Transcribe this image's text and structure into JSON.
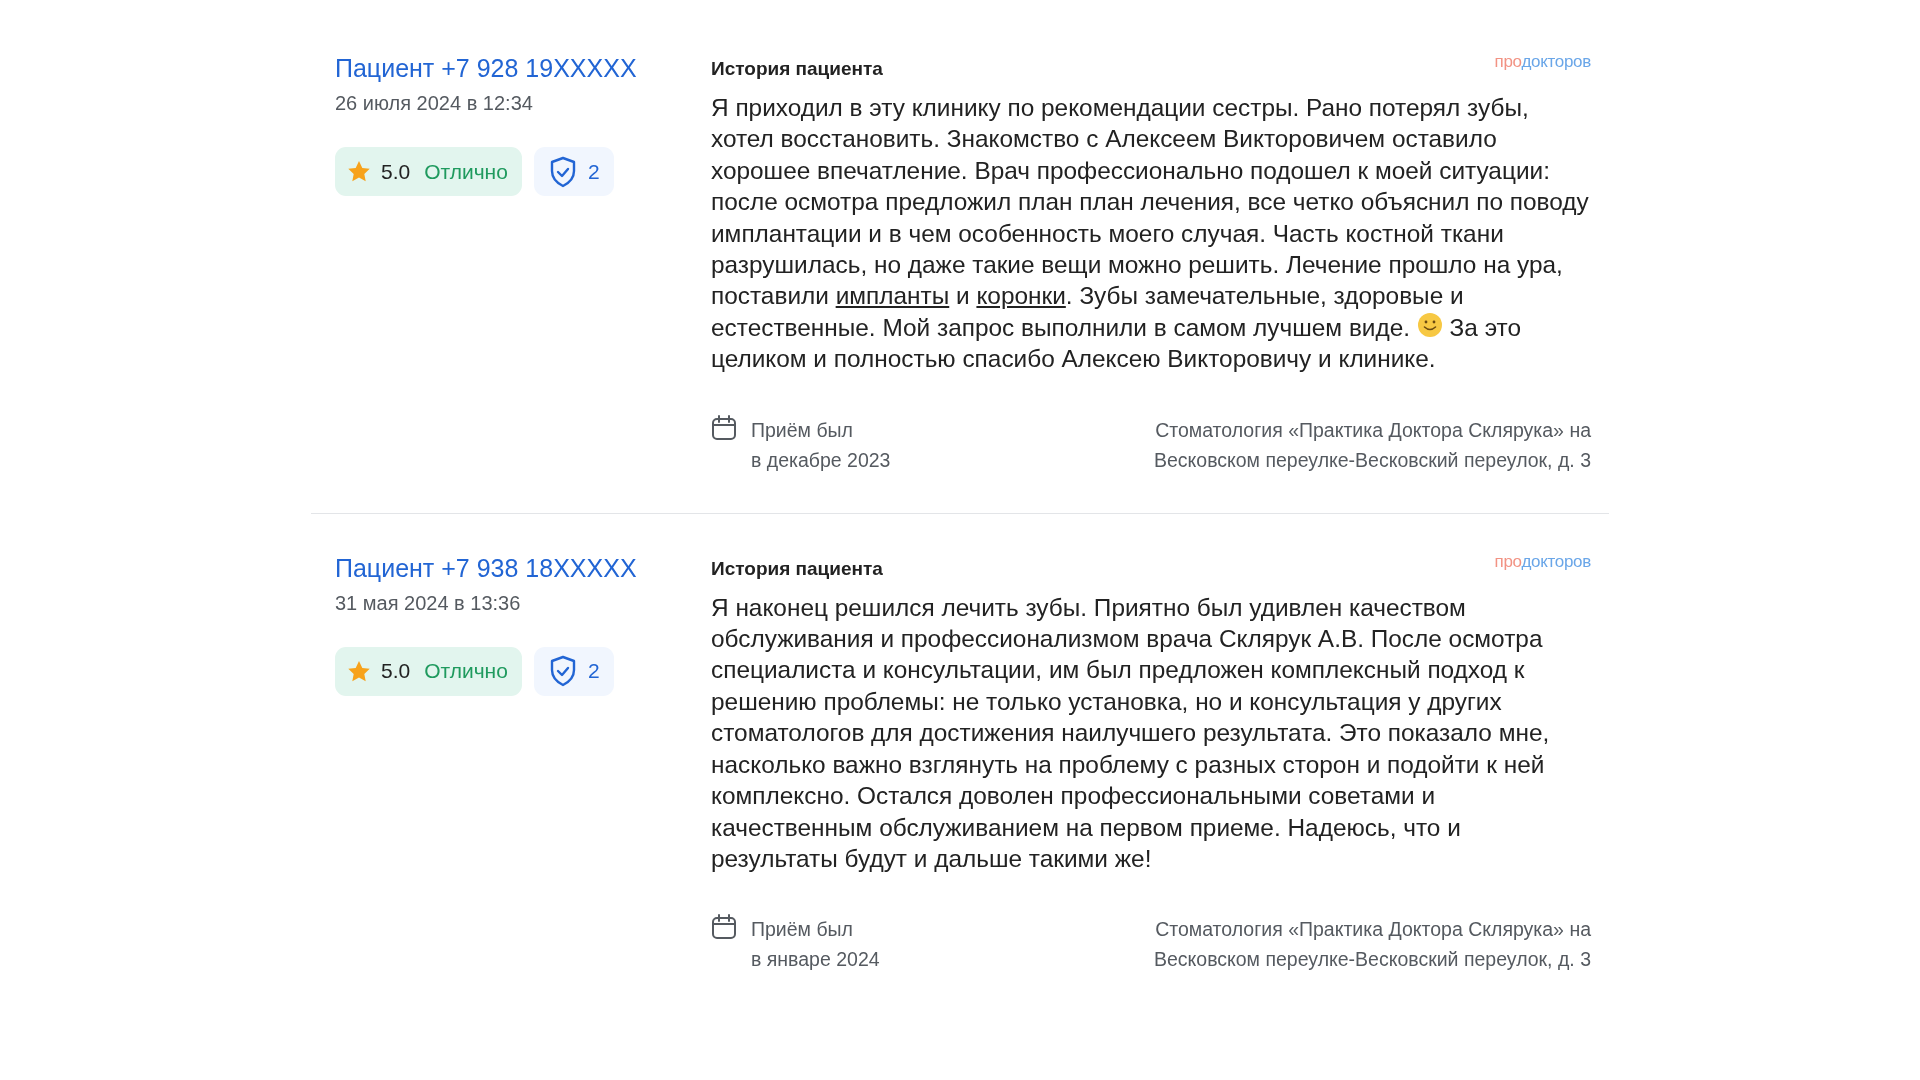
{
  "reviews": [
    {
      "author": "Пациент +7 928 19XXXXX",
      "date": "26 июля 2024 в 12:34",
      "rating": {
        "score": "5.0",
        "label": "Отлично"
      },
      "verified_count": "2",
      "heading": "История пациента",
      "brand": {
        "first": "про",
        "second": "докторов"
      },
      "body": [
        {
          "kind": "text",
          "text": "Я приходил в эту клинику по рекомендации сестры. Рано потерял зубы, хотел восстановить. Знакомство с Алексеем Викторовичем оставило хорошее впечатление. Врач профессионально подошел к моей ситуации: после осмотра предложил план план лечения, все четко объяснил по поводу имплантации и в чем особенность моего случая. Часть костной ткани разрушилась, но даже такие вещи можно решить. Лечение прошло на ура, поставили "
        },
        {
          "kind": "link",
          "text": "импланты"
        },
        {
          "kind": "text",
          "text": " и "
        },
        {
          "kind": "link",
          "text": "коронки"
        },
        {
          "kind": "text",
          "text": ". Зубы замечательные, здоровые и естественные. Мой запрос выполнили в самом лучшем виде. "
        },
        {
          "kind": "emoji"
        },
        {
          "kind": "text",
          "text": " За это целиком и полностью спасибо Алексею Викторовичу и клинике."
        }
      ],
      "visit": [
        "Приём был",
        "в декабре 2023"
      ],
      "clinic": [
        "Стоматология «Практика Доктора Склярука» на",
        "Весковском переулке-Весковский переулок, д. 3"
      ]
    },
    {
      "author": "Пациент +7 938 18XXXXX",
      "date": "31 мая 2024 в 13:36",
      "rating": {
        "score": "5.0",
        "label": "Отлично"
      },
      "verified_count": "2",
      "heading": "История пациента",
      "brand": {
        "first": "про",
        "second": "докторов"
      },
      "body": [
        {
          "kind": "text",
          "text": "Я наконец решился лечить зубы. Приятно был удивлен качеством обслуживания и профессионализмом врача Склярук А.В. После осмотра специалиста и консультации, им был предложен комплексный подход к решению проблемы: не только установка, но и консультация у других стоматологов для достижения наилучшего результата. Это показало мне, насколько важно взглянуть на проблему с разных сторон и подойти к ней комплексно. Остался доволен профессиональными советами и качественным обслуживанием на первом приеме. Надеюсь, что и результаты будут и дальше такими же!"
        }
      ],
      "visit": [
        "Приём был",
        "в январе 2024"
      ],
      "clinic": [
        "Стоматология «Практика Доктора Склярука» на",
        "Весковском переулке-Весковский переулок, д. 3"
      ]
    }
  ]
}
